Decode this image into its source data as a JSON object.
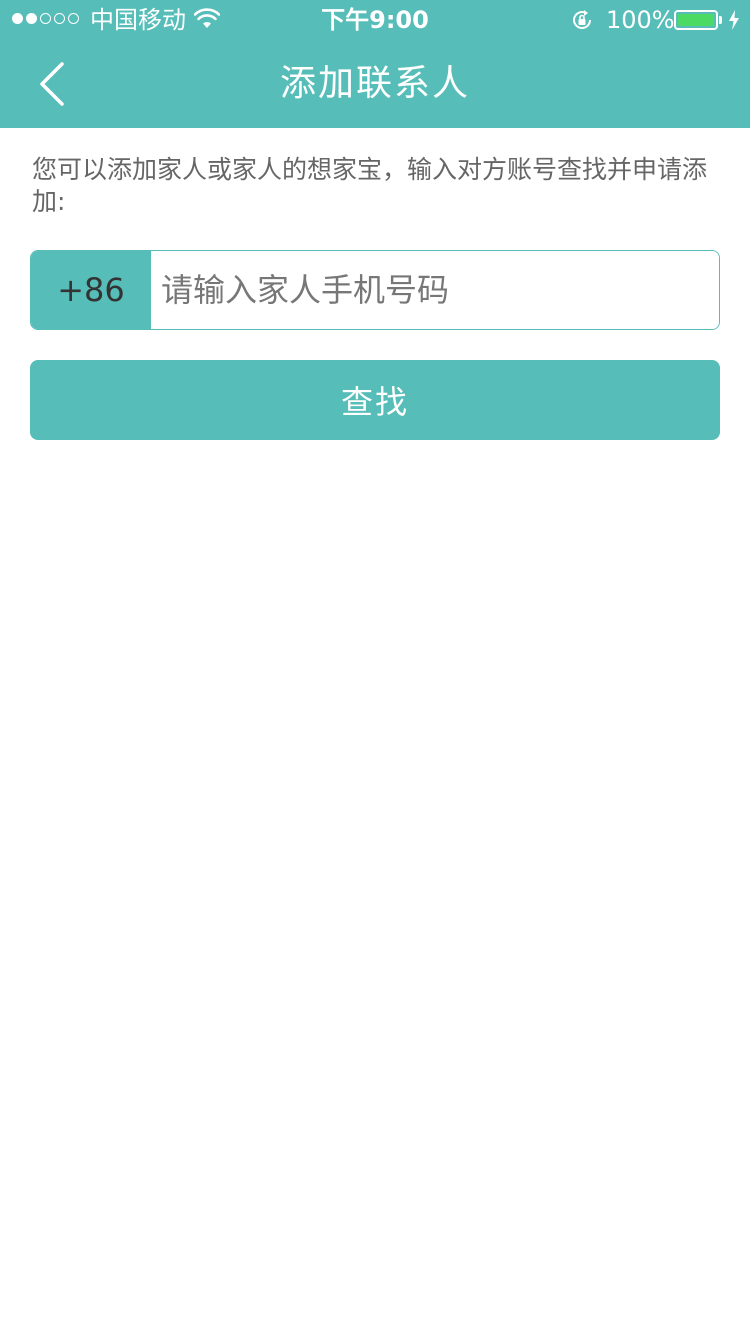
{
  "status_bar": {
    "signal_bars_filled": 2,
    "signal_bars_total": 5,
    "carrier": "中国移动",
    "time": "下午9:00",
    "battery_percent": "100%",
    "battery_level": 1.0,
    "battery_color": "#4cd964",
    "icons": [
      "wifi-icon",
      "rotation-lock-icon",
      "battery-icon",
      "charging-icon"
    ]
  },
  "nav": {
    "title": "添加联系人",
    "back_icon": "chevron-left-icon"
  },
  "main": {
    "intro_text": "您可以添加家人或家人的想家宝，输入对方账号查找并申请添加:",
    "country_code": "+86",
    "phone_placeholder": "请输入家人手机号码",
    "phone_value": "",
    "search_label": "查找"
  },
  "colors": {
    "accent": "#56bdb9",
    "background": "#ffffff",
    "text_secondary": "#666666"
  }
}
